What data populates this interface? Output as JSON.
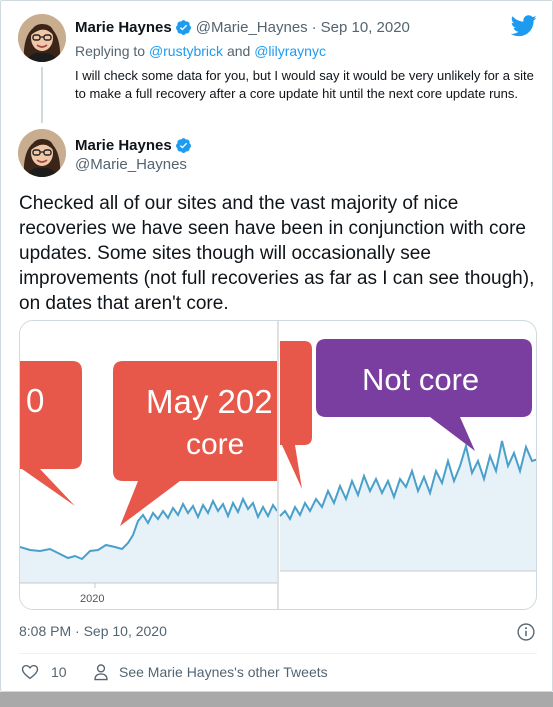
{
  "reply_tweet": {
    "author_name": "Marie Haynes",
    "author_handle": "@Marie_Haynes",
    "date": "Sep 10, 2020",
    "separator": "·",
    "replying_prefix": "Replying to",
    "replying_user_1": "@rustybrick",
    "replying_and": "and",
    "replying_user_2": "@lilyraynyc",
    "text": "I will check some data for you, but I would say it would be very unlikely for a site to make a full recovery after a core update hit until the next core update runs."
  },
  "main_tweet": {
    "author_name": "Marie Haynes",
    "author_handle": "@Marie_Haynes",
    "text": "Checked all of our sites and the vast majority of nice recoveries we have seen have been in conjunction with core updates. Some sites though will occasionally see improvements (not full recoveries as far as I can see though), on dates that aren't core.",
    "timestamp": "8:08 PM · Sep 10, 2020",
    "like_count": "10",
    "other_tweets_label": "See Marie Haynes's other Tweets"
  },
  "media": {
    "left_panel": {
      "bubble_fragment": "0",
      "bubble_line_1": "May 202",
      "bubble_line_2": "core",
      "axis_label": "2020"
    },
    "right_panel": {
      "bubble_label": "Not core"
    }
  },
  "icons": {
    "verified": "verified-badge-icon",
    "brand": "twitter-bird-icon",
    "info": "info-icon",
    "like": "heart-icon",
    "profile": "person-icon"
  },
  "colors": {
    "accent": "#1d9bf0",
    "secondary_text": "#536471",
    "bubble_red": "#e8584a",
    "bubble_purple": "#7a3ea0",
    "line_blue": "#4a9fcb"
  }
}
